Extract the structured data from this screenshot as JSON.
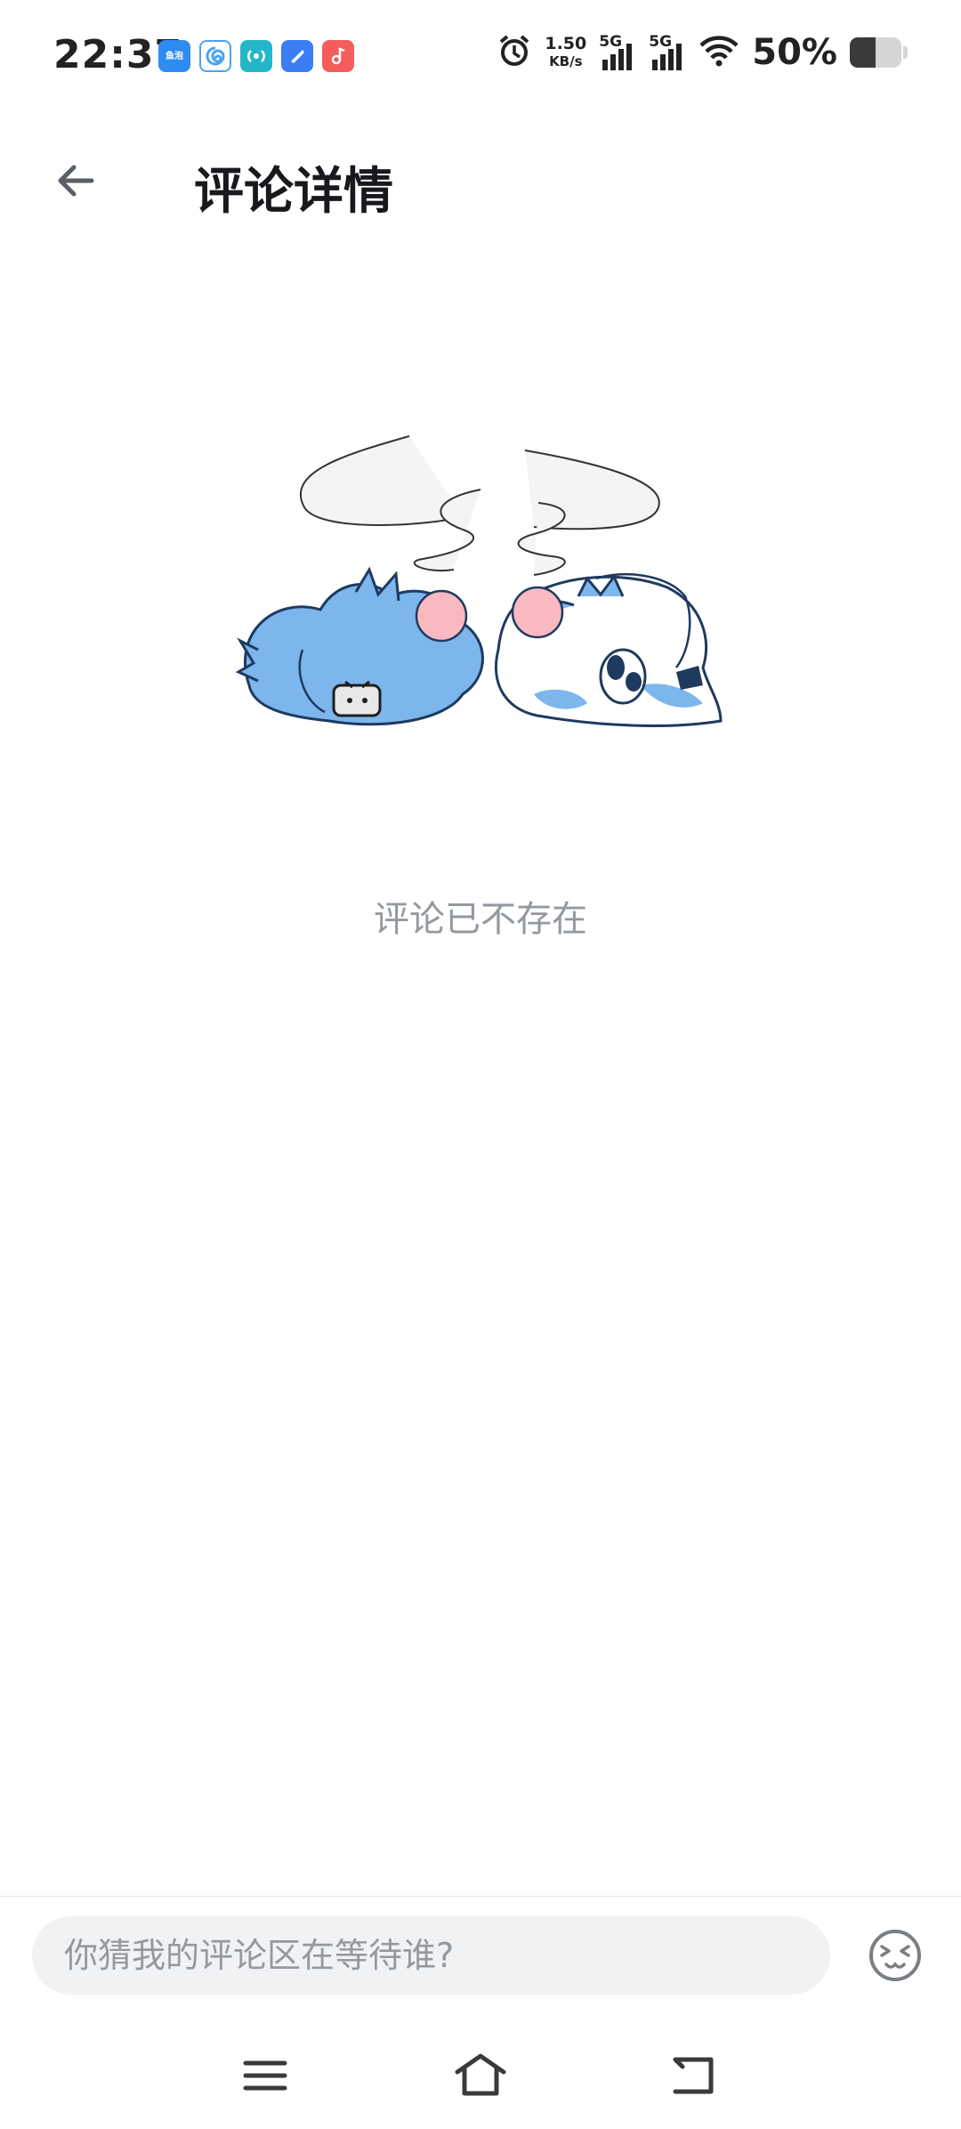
{
  "status_bar": {
    "time": "22:37",
    "net_speed_value": "1.50",
    "net_speed_unit": "KB/s",
    "signal1_label": "5G",
    "signal2_label": "5G",
    "battery_percent": "50%",
    "battery_level": 0.5,
    "notification_icons": [
      {
        "name": "fishbubble-app-icon",
        "color": "#2e8bf0",
        "text": "鱼泡"
      },
      {
        "name": "swirl-app-icon",
        "color": "#4aa3f5"
      },
      {
        "name": "wifi-helper-app-icon",
        "color": "#25b7c9"
      },
      {
        "name": "blue-app-icon",
        "color": "#3b7df5"
      },
      {
        "name": "music-app-icon",
        "color": "#f55d5d"
      }
    ]
  },
  "header": {
    "back_icon": "arrow-left-icon",
    "title": "评论详情"
  },
  "main": {
    "empty_message": "评论已不存在"
  },
  "comment_bar": {
    "placeholder": "你猜我的评论区在等待谁?",
    "emoji_icon": "emoji-face-icon"
  },
  "nav_bar": {
    "menu_icon": "menu-icon",
    "home_icon": "home-icon",
    "back_icon": "back-icon"
  },
  "colors": {
    "accent_blue": "#7cb6ec",
    "text_primary": "#18191c",
    "text_secondary": "#9499a0",
    "input_bg": "#f1f2f3"
  }
}
